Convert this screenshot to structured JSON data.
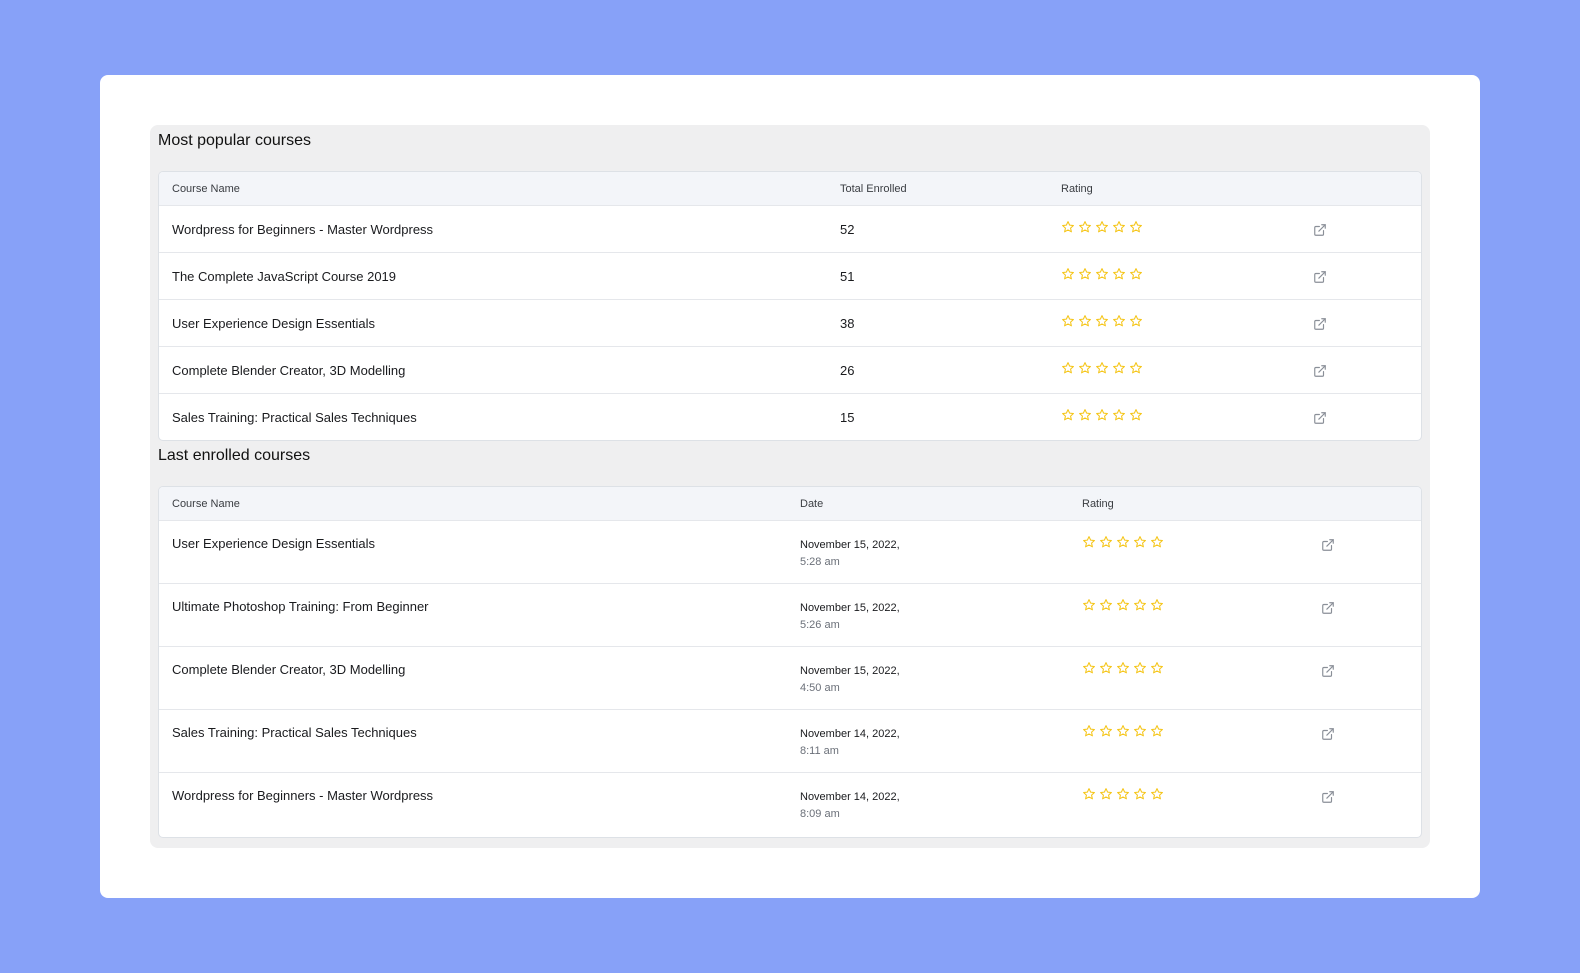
{
  "colors": {
    "background": "#87a1f8",
    "star": "#f5c518",
    "icon": "#8a8f98"
  },
  "popular": {
    "title": "Most popular courses",
    "headers": {
      "name": "Course Name",
      "enrolled": "Total Enrolled",
      "rating": "Rating"
    },
    "rows": [
      {
        "name": "Wordpress for Beginners - Master Wordpress",
        "enrolled": "52",
        "rating": 0
      },
      {
        "name": "The Complete JavaScript Course 2019",
        "enrolled": "51",
        "rating": 0
      },
      {
        "name": "User Experience Design Essentials",
        "enrolled": "38",
        "rating": 0
      },
      {
        "name": "Complete Blender Creator, 3D Modelling",
        "enrolled": "26",
        "rating": 0
      },
      {
        "name": "Sales Training: Practical Sales Techniques",
        "enrolled": "15",
        "rating": 0
      }
    ]
  },
  "last": {
    "title": "Last enrolled courses",
    "headers": {
      "name": "Course Name",
      "date": "Date",
      "rating": "Rating"
    },
    "rows": [
      {
        "name": "User Experience Design Essentials",
        "date": "November 15, 2022,",
        "time": "5:28 am",
        "rating": 0
      },
      {
        "name": "Ultimate Photoshop Training: From Beginner",
        "date": "November 15, 2022,",
        "time": "5:26 am",
        "rating": 0
      },
      {
        "name": "Complete Blender Creator, 3D Modelling",
        "date": "November 15, 2022,",
        "time": "4:50 am",
        "rating": 0
      },
      {
        "name": "Sales Training: Practical Sales Techniques",
        "date": "November 14, 2022,",
        "time": "8:11 am",
        "rating": 0
      },
      {
        "name": "Wordpress for Beginners - Master Wordpress",
        "date": "November 14, 2022,",
        "time": "8:09 am",
        "rating": 0
      }
    ]
  },
  "icons": {
    "star": "star-outline-icon",
    "link": "external-link-icon"
  }
}
